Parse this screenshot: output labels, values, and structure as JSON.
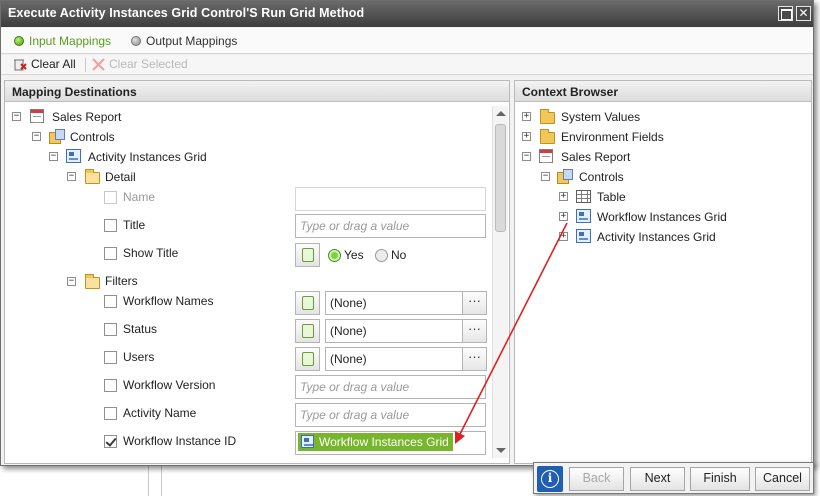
{
  "window": {
    "title": "Execute Activity Instances Grid Control'S Run Grid Method"
  },
  "tabs": [
    {
      "label": "Input Mappings",
      "active": true
    },
    {
      "label": "Output Mappings",
      "active": false
    }
  ],
  "toolbar": {
    "clear_all": "Clear All",
    "clear_selected": "Clear Selected"
  },
  "left_panel": {
    "header": "Mapping Destinations",
    "tree": {
      "root": "Sales Report",
      "controls": "Controls",
      "grid": "Activity Instances Grid",
      "detail": "Detail",
      "filters": "Filters"
    },
    "placeholder": "Type or drag a value",
    "fields": {
      "name": "Name",
      "title": "Title",
      "show_title": "Show Title",
      "workflow_names": "Workflow Names",
      "status": "Status",
      "users": "Users",
      "workflow_version": "Workflow Version",
      "activity_name": "Activity Name",
      "workflow_instance_id": "Workflow Instance ID"
    },
    "show_title_options": {
      "yes": "Yes",
      "no": "No"
    },
    "dropdown_value": "(None)",
    "ellipsis": "···",
    "mapped_value": "Workflow Instances Grid"
  },
  "right_panel": {
    "header": "Context Browser",
    "tree": {
      "system_values": "System Values",
      "environment_fields": "Environment Fields",
      "sales_report": "Sales Report",
      "controls": "Controls",
      "table": "Table",
      "workflow_instances_grid": "Workflow Instances Grid",
      "activity_instances_grid": "Activity Instances Grid"
    }
  },
  "buttons": {
    "info": "i",
    "back": "Back",
    "next": "Next",
    "finish": "Finish",
    "cancel": "Cancel"
  },
  "colors": {
    "accent_green": "#77b62c",
    "drag_arrow": "#e02020",
    "title_bar": "#4a4a4a"
  }
}
